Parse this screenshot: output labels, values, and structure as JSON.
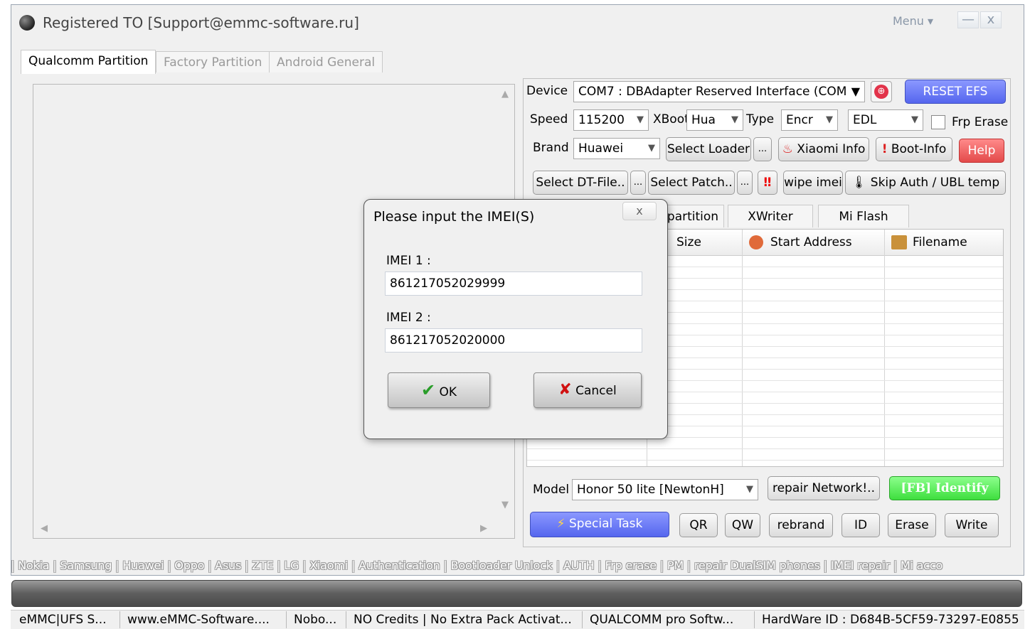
{
  "window": {
    "title": "Registered TO [Support@emmc-software.ru]",
    "menu_label": "Menu",
    "minimize_glyph": "—",
    "close_glyph": "x"
  },
  "main_tabs": [
    {
      "label": "Qualcomm Partition",
      "active": true
    },
    {
      "label": "Factory Partition",
      "active": false
    },
    {
      "label": "Android General",
      "active": false
    }
  ],
  "controls": {
    "device_label": "Device",
    "device_value": "COM7 : DBAdapter Reserved Interface (COM",
    "reset_efs": "RESET EFS",
    "speed_label": "Speed",
    "speed_value": "115200",
    "xboot_label": "XBoot",
    "xboot_value": "Hua",
    "type_label": "Type",
    "type_value": "Encr",
    "mode_value": "EDL",
    "frp_erase_label": "Frp Erase",
    "brand_label": "Brand",
    "brand_value": "Huawei",
    "select_loader": "Select Loader",
    "ellipsis": "...",
    "xiaomi_info": "Xiaomi Info",
    "boot_info": "Boot-Info",
    "help": "Help",
    "select_dt_file": "Select DT-File..",
    "select_patch": "Select Patch..",
    "wipe_imei": "wipe imei",
    "skip_auth": "Skip Auth / UBL temp"
  },
  "sub_tabs": [
    {
      "label": "partition"
    },
    {
      "label": "XWriter"
    },
    {
      "label": "Mi Flash"
    }
  ],
  "grid": {
    "columns": [
      "Size",
      "Start Address",
      "Filename"
    ]
  },
  "bottom": {
    "model_label": "Model",
    "model_value": "Honor 50 lite [NewtonH]",
    "repair_network": "repair Network!..",
    "fb_identify": "[FB] Identify",
    "special_task": "Special Task",
    "qr": "QR",
    "qw": "QW",
    "rebrand": "rebrand",
    "id": "ID",
    "erase": "Erase",
    "write": "Write"
  },
  "marquee": "| Nokia | Samsung | Huawei | Oppo | Asus | ZTE | LG | Xiaomi | Authentication | Bootloader Unlock | AUTH | Frp erase | PM | repair DualSIM phones | IMEI repair | Mi acco",
  "status": [
    "eMMC|UFS S...",
    "www.eMMC-Software....",
    "Nobo...",
    "NO Credits | No Extra Pack Activat...",
    "QUALCOMM pro Softw...",
    "HardWare ID : D684B-5CF59-73297-E0855"
  ],
  "dialog": {
    "title": "Please input the IMEI(S)",
    "close_glyph": "x",
    "imei1_label": "IMEI 1 :",
    "imei1_value": "861217052029999",
    "imei2_label": "IMEI 2 :",
    "imei2_value": "861217052020000",
    "ok": "OK",
    "cancel": "Cancel"
  }
}
